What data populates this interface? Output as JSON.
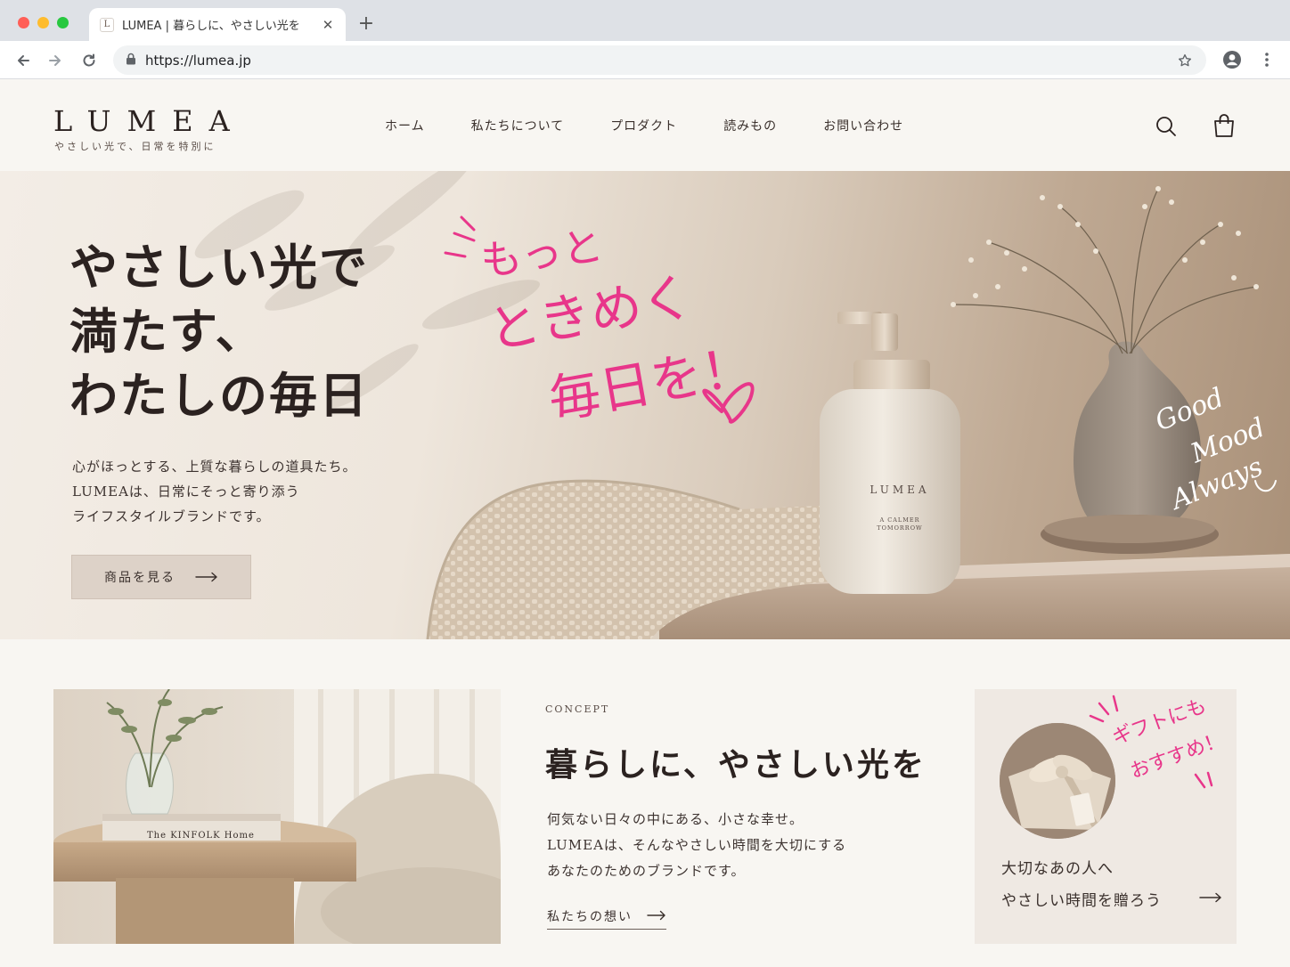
{
  "browser": {
    "tab_title": "LUMEA | 暮らしに、やさしい光を",
    "favicon_text": "L",
    "url": "https://lumea.jp",
    "icons": [
      "back-icon",
      "forward-icon",
      "reload-icon",
      "lock-icon",
      "star-icon",
      "profile-icon",
      "kebab-menu-icon",
      "close-icon",
      "plus-icon"
    ]
  },
  "header": {
    "logo": "LUMEA",
    "tagline": "やさしい光で、日常を特別に",
    "nav": [
      "ホーム",
      "私たちについて",
      "プロダクト",
      "読みもの",
      "お問い合わせ"
    ],
    "icons": [
      "search-icon",
      "shopping-bag-icon"
    ]
  },
  "hero": {
    "title_lines": [
      "やさしい光で",
      "満たす、",
      "わたしの毎日"
    ],
    "copy_lines": [
      "心がほっとする、上質な暮らしの道具たち。",
      "LUMEAは、日常にそっと寄り添う",
      "ライフスタイルブランドです。"
    ],
    "cta_label": "商品を見る",
    "handwritten_lines": [
      "もっと",
      "ときめく",
      "毎日を！"
    ],
    "script_lines": [
      "Good",
      "Mood",
      "Always"
    ],
    "bottle_brand": "LUMEA",
    "bottle_sub": [
      "A CALMER",
      "TOMORROW"
    ],
    "accent_color": "#e8368a"
  },
  "concept": {
    "label": "CONCEPT",
    "title": "暮らしに、やさしい光を",
    "body_lines": [
      "何気ない日々の中にある、小さな幸せ。",
      "LUMEAは、そんなやさしい時間を大切にする",
      "あなたのためのブランドです。"
    ],
    "link_label": "私たちの想い",
    "book_title": "The KINFOLK Home"
  },
  "gift": {
    "handwritten_lines": [
      "ギフトにも",
      "おすすめ！"
    ],
    "text_lines": [
      "大切なあの人へ",
      "やさしい時間を贈ろう"
    ]
  }
}
